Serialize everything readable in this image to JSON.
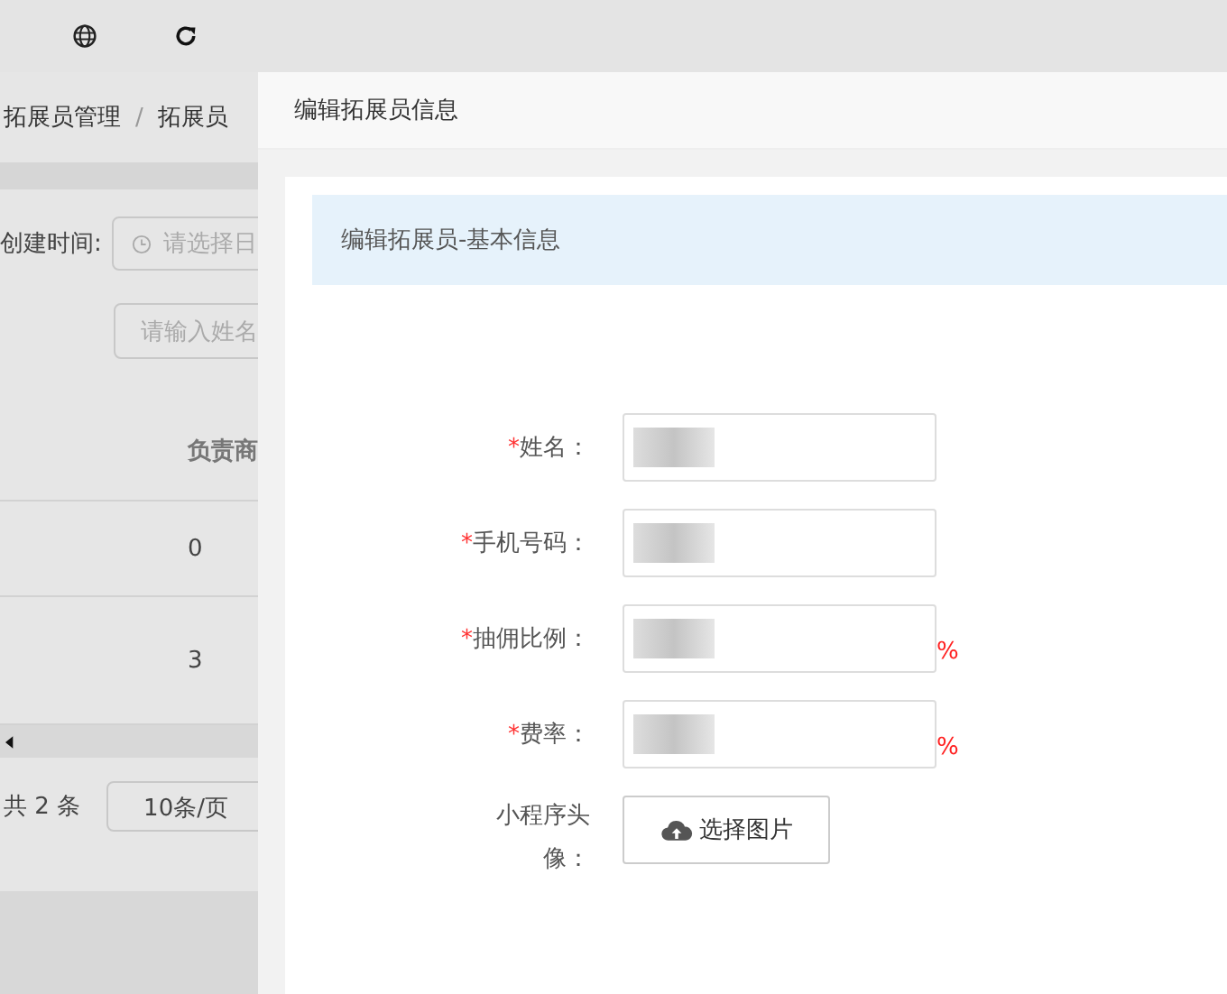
{
  "background_page": {
    "breadcrumb": [
      "拓展员管理",
      "拓展员"
    ],
    "breadcrumb_separator": "/",
    "filters": {
      "created_label": "创建时间:",
      "date_placeholder": "请选择日",
      "name_placeholder": "请输入姓名"
    },
    "table": {
      "columns": [
        "负责商"
      ],
      "rows": [
        [
          "0"
        ],
        [
          "3"
        ]
      ]
    },
    "pagination": {
      "total": "共 2 条",
      "page_size": "10条/页"
    }
  },
  "drawer": {
    "title": "编辑拓展员信息",
    "required_mark": "*",
    "section_title": "编辑拓展员-基本信息",
    "fields": [
      {
        "kind": "input",
        "label": "姓名：",
        "required": true,
        "blurred": true
      },
      {
        "kind": "input",
        "label": "手机号码：",
        "required": true,
        "blurred": true
      },
      {
        "kind": "input",
        "label": "抽佣比例：",
        "required": true,
        "blurred": true,
        "suffix": "%"
      },
      {
        "kind": "input",
        "label": "费率：",
        "required": true,
        "blurred": true,
        "suffix": "%"
      },
      {
        "kind": "upload",
        "label": "小程序头像：",
        "required": false,
        "button": "选择图片"
      }
    ]
  }
}
